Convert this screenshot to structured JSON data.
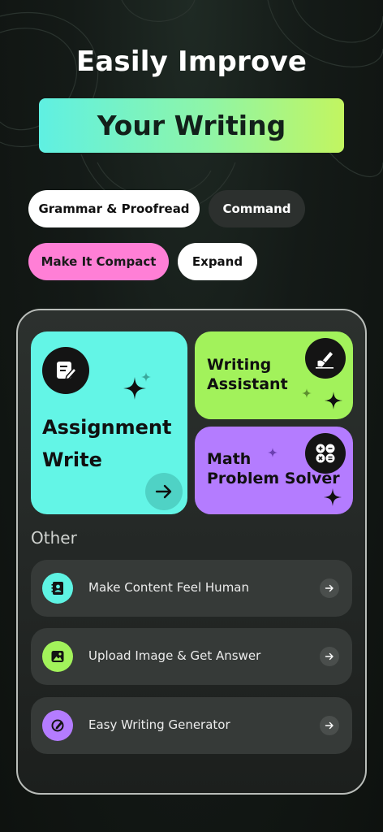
{
  "header": {
    "title_line1": "Easily Improve",
    "title_line2": "Your Writing"
  },
  "chips": {
    "grammar": "Grammar & Proofread",
    "command": "Command",
    "compact": "Make It Compact",
    "expand": "Expand"
  },
  "cards": {
    "assignment": {
      "line1": "Assignment",
      "line2": "Write",
      "icon": "edit-document-icon"
    },
    "writing": {
      "line1": "Writing",
      "line2": "Assistant",
      "icon": "hand-writing-icon"
    },
    "math": {
      "line1": "Math",
      "line2": "Problem Solver",
      "icon": "calculator-icon"
    }
  },
  "other": {
    "label": "Other",
    "items": [
      {
        "label": "Make Content Feel Human",
        "icon": "contact-book-icon",
        "icon_color": "#5ef3e3"
      },
      {
        "label": "Upload Image & Get Answer",
        "icon": "image-upload-icon",
        "icon_color": "#a2f25b"
      },
      {
        "label": "Easy Writing Generator",
        "icon": "pen-circle-icon",
        "icon_color": "#b47cff"
      }
    ]
  },
  "colors": {
    "hero_gradient_start": "#5ff0e2",
    "hero_gradient_end": "#c2f560",
    "cyan": "#63f5e6",
    "lime": "#a2f25b",
    "purple": "#b47cff",
    "pink": "#ff7fd6"
  }
}
